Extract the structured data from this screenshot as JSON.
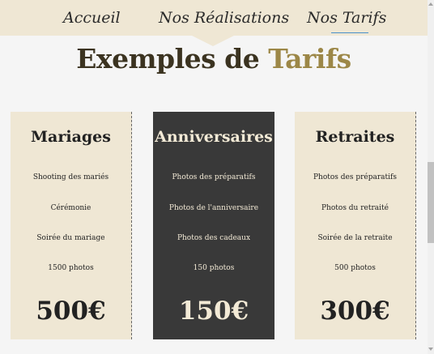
{
  "nav": {
    "items": [
      {
        "label": "Accueil"
      },
      {
        "label": "Nos Réalisations"
      },
      {
        "label": "Nos Tarifs"
      }
    ]
  },
  "section": {
    "title_part1": "Exemples de",
    "title_part2": "Tarifs"
  },
  "cards": [
    {
      "title": "Mariages",
      "features": [
        "Shooting des mariés",
        "Cérémonie",
        "Soirée du mariage",
        "1500 photos"
      ],
      "price": "500€"
    },
    {
      "title": "Anniversaires",
      "features": [
        "Photos des préparatifs",
        "Photos de l'anniversaire",
        "Photos des cadeaux",
        "150 photos"
      ],
      "price": "150€"
    },
    {
      "title": "Retraites",
      "features": [
        "Photos des préparatifs",
        "Photos du retraité",
        "Soirée de la retraite",
        "500 photos"
      ],
      "price": "300€"
    }
  ],
  "colors": {
    "nav_bg": "#efe7d4",
    "card_light": "#efe7d4",
    "card_dark": "#393939",
    "title_accent": "#9c8747",
    "active_underline": "#4a90c9"
  }
}
